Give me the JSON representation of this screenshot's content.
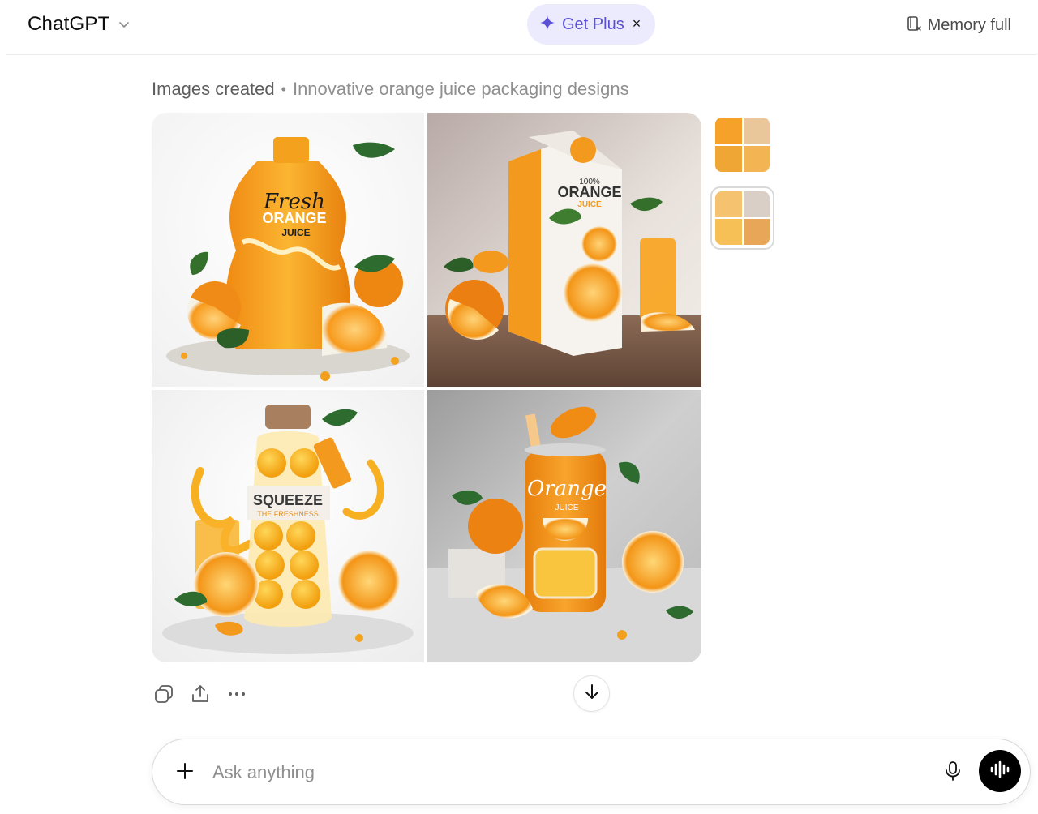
{
  "header": {
    "model_name": "ChatGPT",
    "get_plus_label": "Get Plus",
    "get_plus_close": "×",
    "memory_label": "Memory full"
  },
  "message": {
    "caption_main": "Images created",
    "caption_separator": "•",
    "caption_subtitle": "Innovative orange juice packaging designs"
  },
  "images": [
    {
      "label_1": "Fresh",
      "label_2": "ORANGE",
      "label_3": "JUICE"
    },
    {
      "label_1": "100%",
      "label_2": "ORANGE",
      "label_3": "JUICE"
    },
    {
      "label_1": "SQUEEZE",
      "label_2": "THE FRESHNESS"
    },
    {
      "label_1": "Orange",
      "label_2": "JUICE"
    }
  ],
  "thumbnails": [
    {
      "selected": false
    },
    {
      "selected": true
    }
  ],
  "composer": {
    "placeholder": "Ask anything"
  },
  "colors": {
    "accent": "#5b4fd6",
    "get_plus_bg": "#ecebfd",
    "orange": "#f39a1e"
  },
  "icons": {
    "model_chevron": "chevron-down-icon",
    "get_plus": "sparkle-icon",
    "memory": "memory-icon",
    "copy": "copy-icon",
    "share": "share-icon",
    "more": "more-icon",
    "scroll": "arrow-down-icon",
    "attach": "plus-icon",
    "mic": "microphone-icon",
    "voice": "voice-wave-icon"
  }
}
